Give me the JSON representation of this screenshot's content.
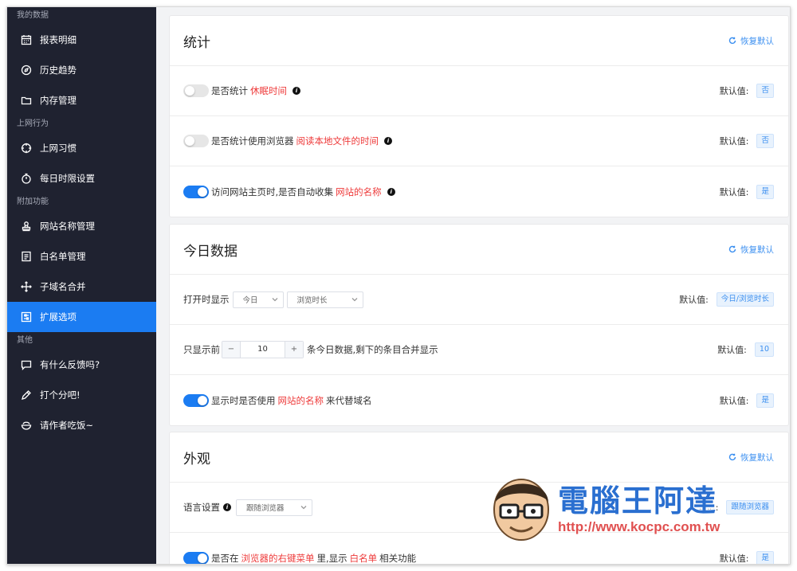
{
  "sidebar": {
    "groups": [
      {
        "title": "我的数据",
        "items": [
          {
            "label": "报表明细",
            "icon": "calendar-icon"
          },
          {
            "label": "历史趋势",
            "icon": "compass-icon"
          },
          {
            "label": "内存管理",
            "icon": "folder-icon"
          }
        ]
      },
      {
        "title": "上网行为",
        "items": [
          {
            "label": "上网习惯",
            "icon": "crosshair-icon"
          },
          {
            "label": "每日时限设置",
            "icon": "stopwatch-icon"
          }
        ]
      },
      {
        "title": "附加功能",
        "items": [
          {
            "label": "网站名称管理",
            "icon": "stamp-icon"
          },
          {
            "label": "白名单管理",
            "icon": "list-doc-icon"
          },
          {
            "label": "子域名合并",
            "icon": "arrows-icon"
          },
          {
            "label": "扩展选项",
            "icon": "options-icon",
            "active": true
          }
        ]
      },
      {
        "title": "其他",
        "items": [
          {
            "label": "有什么反馈吗?",
            "icon": "chat-icon"
          },
          {
            "label": "打个分吧!",
            "icon": "pen-icon"
          },
          {
            "label": "请作者吃饭~",
            "icon": "food-icon"
          }
        ]
      }
    ]
  },
  "cards": {
    "stats": {
      "title": "统计",
      "reset": "恢复默认",
      "rows": [
        {
          "pre": "是否统计",
          "hl": "休眠时间",
          "post": "",
          "on": false,
          "default_label": "默认值:",
          "default_value": "否"
        },
        {
          "pre": "是否统计使用浏览器",
          "hl": "阅读本地文件的时间",
          "post": "",
          "on": false,
          "default_label": "默认值:",
          "default_value": "否"
        },
        {
          "pre": "访问网站主页时,是否自动收集",
          "hl": "网站的名称",
          "post": "",
          "on": true,
          "default_label": "默认值:",
          "default_value": "是"
        }
      ]
    },
    "today": {
      "title": "今日数据",
      "reset": "恢复默认",
      "open_label": "打开时显示",
      "select1": "今日",
      "select2": "浏览时长",
      "default1_label": "默认值:",
      "default1_value": "今日/浏览时长",
      "show_pre": "只显示前",
      "minus": "−",
      "count": "10",
      "plus": "+",
      "show_post": "条今日数据,剩下的条目合并显示",
      "default2_label": "默认值:",
      "default2_value": "10",
      "row3_pre": "显示时是否使用",
      "row3_hl": "网站的名称",
      "row3_post": "来代替域名",
      "default3_label": "默认值:",
      "default3_value": "是"
    },
    "appearance": {
      "title": "外观",
      "reset": "恢复默认",
      "lang_label": "语言设置",
      "lang_select": "跟随浏览器",
      "default1_label": "默认值:",
      "default1_value": "跟随浏览器",
      "row2_pre": "是否在",
      "row2_hl1": "浏览器的右键菜单",
      "row2_mid": "里,显示",
      "row2_hl2": "白名单",
      "row2_post": "相关功能",
      "default2_label": "默认值:",
      "default2_value": "是"
    }
  },
  "watermark": {
    "title": "電腦王阿達",
    "url": "http://www.kocpc.com.tw"
  },
  "colors": {
    "sidebar_bg": "#1f2230",
    "accent": "#1b7cf2",
    "highlight": "#ee3a3a"
  }
}
